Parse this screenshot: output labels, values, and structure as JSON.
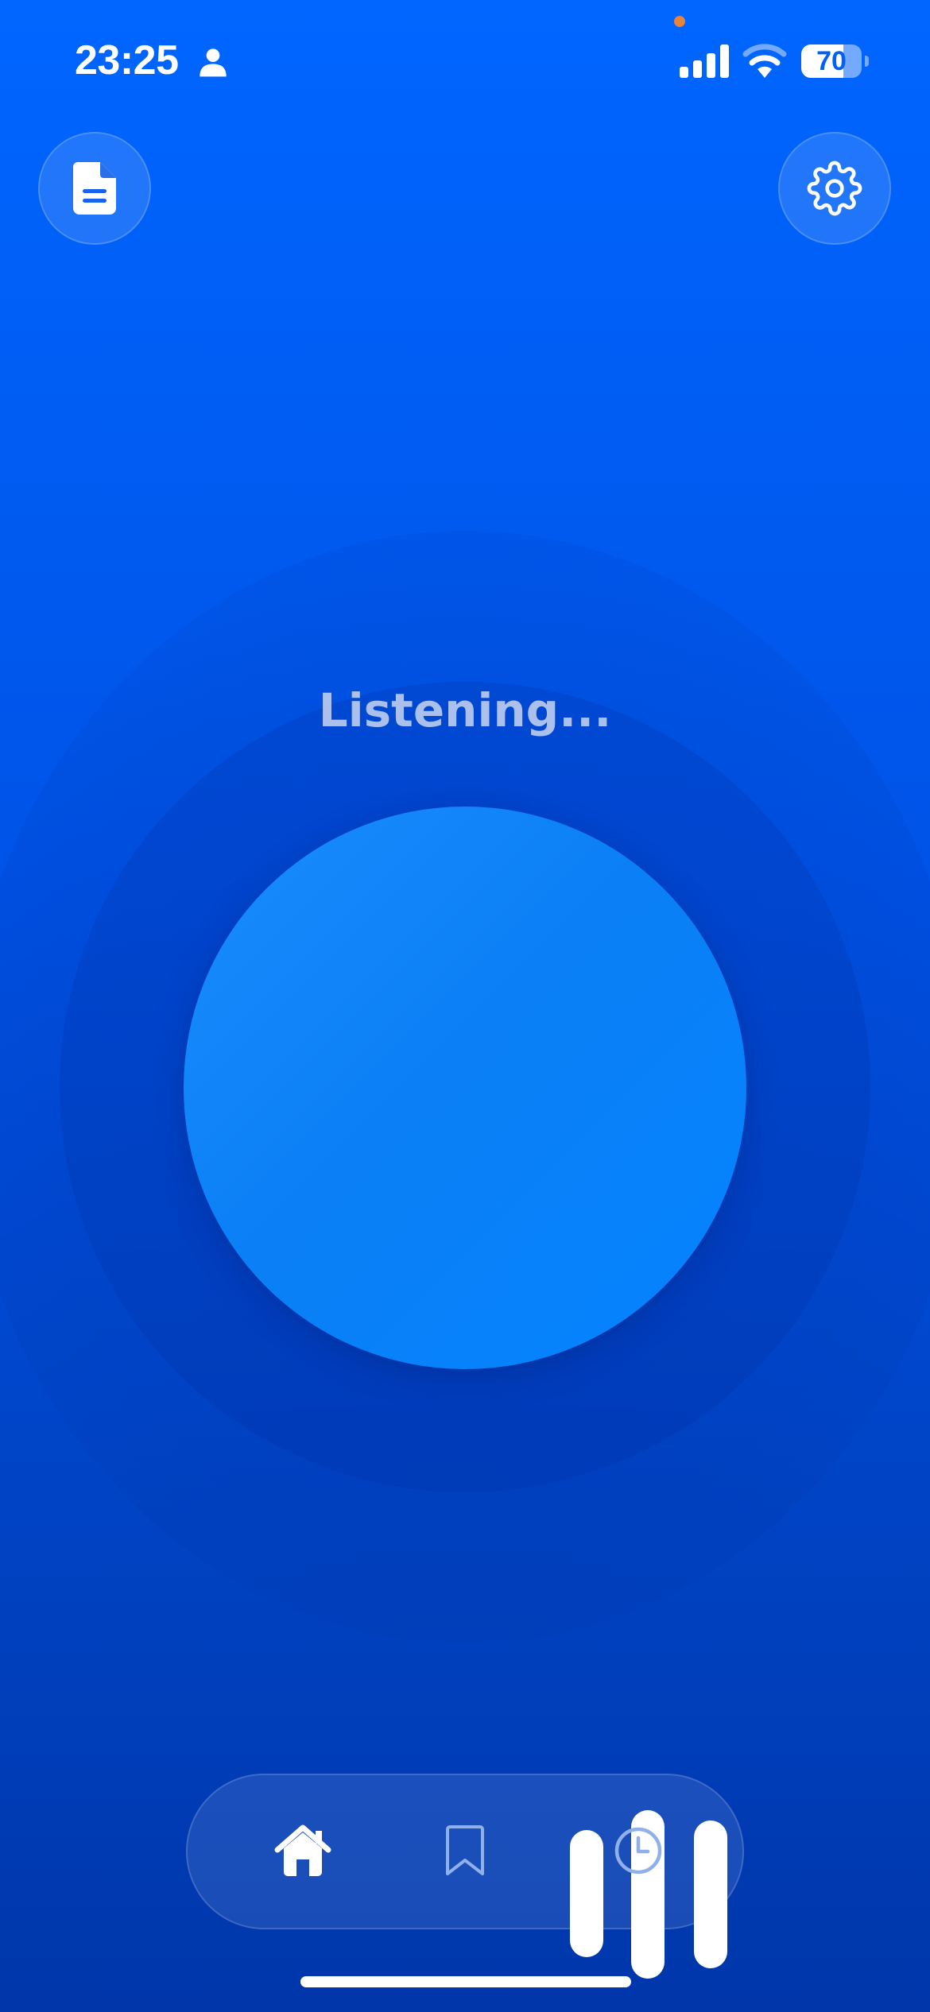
{
  "status_bar": {
    "time": "23:25",
    "battery_level": 70,
    "battery_label": "70",
    "icons": [
      "person-icon",
      "signal-icon",
      "wifi-icon",
      "battery-icon"
    ],
    "privacy_dot_color": "#e8833a"
  },
  "top_bar": {
    "left_button_icon": "document-icon",
    "right_button_icon": "gear-icon"
  },
  "main": {
    "status_text": "Listening...",
    "center_icon": "audio-bars-icon"
  },
  "tab_bar": {
    "tabs": [
      {
        "icon": "home-icon",
        "active": true
      },
      {
        "icon": "bookmark-icon",
        "active": false
      },
      {
        "icon": "clock-icon",
        "active": false
      }
    ]
  },
  "colors": {
    "background_top": "#0066ff",
    "background_bottom": "#0036aa",
    "accent": "#0a84ff",
    "active_icon": "#ffffff",
    "inactive_icon": "#8fb0ea"
  }
}
